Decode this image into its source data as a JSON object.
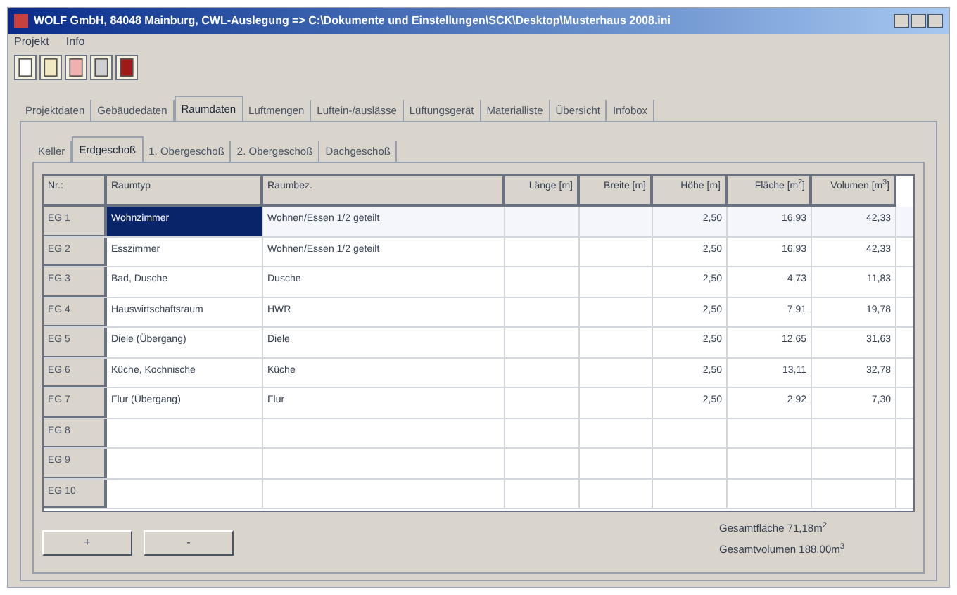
{
  "window": {
    "title": "WOLF GmbH, 84048 Mainburg, CWL-Auslegung  => C:\\Dokumente und Einstellungen\\SCK\\Desktop\\Musterhaus 2008.ini"
  },
  "menu": [
    "Projekt",
    "Info"
  ],
  "tabs": [
    {
      "label": "Projektdaten",
      "selected": false
    },
    {
      "label": "Gebäudedaten",
      "selected": false
    },
    {
      "label": "Raumdaten",
      "selected": true
    },
    {
      "label": "Luftmengen",
      "selected": false
    },
    {
      "label": "Luftein-/auslässe",
      "selected": false
    },
    {
      "label": "Lüftungsgerät",
      "selected": false
    },
    {
      "label": "Materialliste",
      "selected": false
    },
    {
      "label": "Übersicht",
      "selected": false
    },
    {
      "label": "Infobox",
      "selected": false
    }
  ],
  "floor_tabs": [
    {
      "label": "Keller",
      "selected": false
    },
    {
      "label": "Erdgeschoß",
      "selected": true
    },
    {
      "label": "1. Obergeschoß",
      "selected": false
    },
    {
      "label": "2. Obergeschoß",
      "selected": false
    },
    {
      "label": "Dachgeschoß",
      "selected": false
    }
  ],
  "table": {
    "columns": [
      "Nr.:",
      "Raumtyp",
      "Raumbez.",
      "Länge [m]",
      "Breite [m]",
      "Höhe [m]",
      "Fläche [m$^{2}$]",
      "Volumen [m$^{3}$]"
    ],
    "rows": [
      {
        "nr": "EG 1",
        "raumtyp": "Wohnzimmer",
        "selected": true,
        "raumbez": "Wohnen/Essen 1/2 geteilt",
        "hoehe": "2,50",
        "flaeche": "16,93",
        "volumen": "42,33"
      },
      {
        "nr": "EG 2",
        "raumtyp": "Esszimmer",
        "selected": false,
        "raumbez": "Wohnen/Essen 1/2 geteilt",
        "hoehe": "2,50",
        "flaeche": "16,93",
        "volumen": "42,33"
      },
      {
        "nr": "EG 3",
        "raumtyp": "Bad, Dusche",
        "selected": false,
        "raumbez": "Dusche",
        "hoehe": "2,50",
        "flaeche": "4,73",
        "volumen": "11,83"
      },
      {
        "nr": "EG 4",
        "raumtyp": "Hauswirtschaftsraum",
        "selected": false,
        "raumbez": "HWR",
        "hoehe": "2,50",
        "flaeche": "7,91",
        "volumen": "19,78"
      },
      {
        "nr": "EG 5",
        "raumtyp": "Diele (Übergang)",
        "selected": false,
        "raumbez": "Diele",
        "hoehe": "2,50",
        "flaeche": "12,65",
        "volumen": "31,63"
      },
      {
        "nr": "EG 6",
        "raumtyp": "Küche, Kochnische",
        "selected": false,
        "raumbez": "Küche",
        "hoehe": "2,50",
        "flaeche": "13,11",
        "volumen": "32,78"
      },
      {
        "nr": "EG 7",
        "raumtyp": "Flur (Übergang)",
        "selected": false,
        "raumbez": "Flur",
        "hoehe": "2,50",
        "flaeche": "2,92",
        "volumen": "7,30"
      },
      {
        "nr": "EG 8",
        "selected": false
      },
      {
        "nr": "EG 9",
        "selected": false
      },
      {
        "nr": "EG 10",
        "selected": false
      }
    ]
  },
  "buttons": [
    "+",
    "-"
  ],
  "totals": [
    "Gesamtfläche 71,18m$^{2}$",
    "Gesamtvolumen 188,00m$^{3}$"
  ]
}
